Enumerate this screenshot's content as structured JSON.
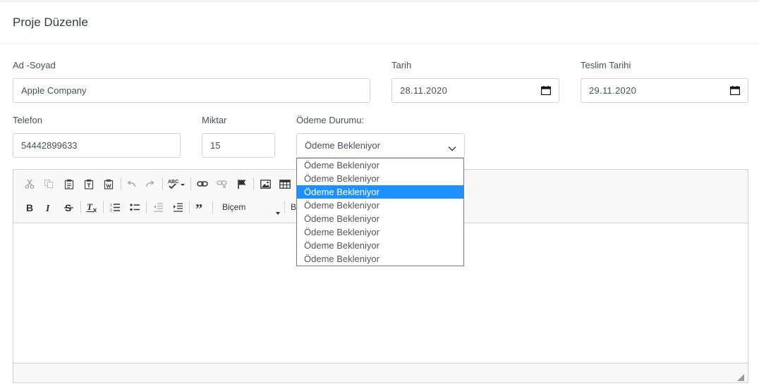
{
  "header": {
    "title": "Proje Düzenle"
  },
  "form": {
    "name": {
      "label": "Ad -Soyad",
      "value": "Apple Company"
    },
    "date": {
      "label": "Tarih",
      "value": "28.11.2020"
    },
    "due_date": {
      "label": "Teslim Tarihi",
      "value": "29.11.2020"
    },
    "phone": {
      "label": "Telefon",
      "value": "54442899633"
    },
    "amount": {
      "label": "Miktar",
      "value": "15"
    },
    "payment": {
      "label": "Ödeme Durumu:",
      "value": "Ödeme Bekleniyor",
      "options": [
        "Ödeme Bekleniyor",
        "Ödeme Bekleniyor",
        "Ödeme Bekleniyor",
        "Ödeme Bekleniyor",
        "Ödeme Bekleniyor",
        "Ödeme Bekleniyor",
        "Ödeme Bekleniyor",
        "Ödeme Bekleniyor"
      ],
      "selected_index": 2
    }
  },
  "editor": {
    "format_label": "Biçem",
    "size_label_partial": "B",
    "body": ""
  },
  "colors": {
    "highlight": "#1e90ff",
    "border": "#ced4da"
  }
}
